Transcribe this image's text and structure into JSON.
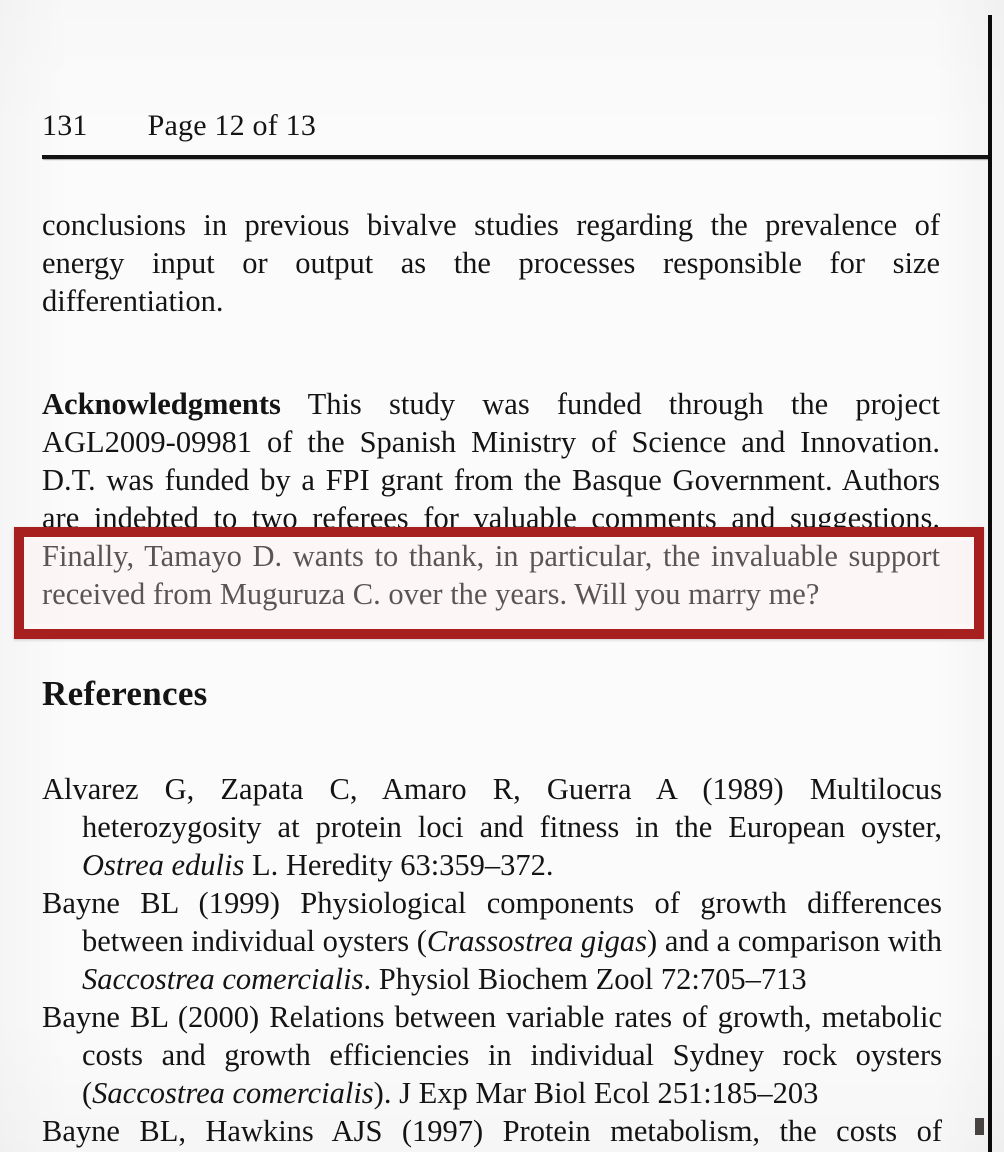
{
  "page": {
    "running_head": {
      "folio": "131",
      "page_indicator": "Page 12 of 13"
    }
  },
  "body": {
    "paragraph_conclusions": "conclusions in previous bivalve studies regarding the prevalence of energy input or output as the processes responsible for size differentiation.",
    "acknowledgments_label": "Acknowledgments",
    "acknowledgments_text": " This study was funded through the project AGL2009-09981 of the Spanish Ministry of Science and Innovation. D.T. was funded by a FPI grant from the Basque Government. Authors are indebted to two referees for valuable comments and suggestions. Finally, Tamayo D. wants to thank, in particular, the invaluable support received from Muguruza C. over the years. Will you marry me?"
  },
  "references": {
    "heading": "References",
    "items": [
      {
        "pre": "Alvarez G, Zapata C, Amaro R, Guerra A (1989) Multilocus heterozygosity at protein loci and fitness in the European oyster, ",
        "italic": "Ostrea edulis",
        "post": " L. Heredity 63:359–372."
      },
      {
        "pre": "Bayne BL (1999) Physiological components of growth differences between individual oysters (",
        "italic": "Crassostrea gigas",
        "mid": ") and a comparison with ",
        "italic2": "Saccostrea comercialis",
        "post": ". Physiol Biochem Zool 72:705–713"
      },
      {
        "pre": "Bayne BL (2000) Relations between variable rates of growth, metabolic costs and growth efficiencies in individual Sydney rock oysters (",
        "italic": "Saccostrea comercialis",
        "post": "). J Exp Mar Biol Ecol 251:185–203"
      },
      {
        "pre": "Bayne BL, Hawkins AJS (1997) Protein metabolism, the costs of",
        "italic": "",
        "post": ""
      }
    ]
  },
  "annotation": {
    "highlight_color": "#a81f1f",
    "highlighted_text": "tions. Finally, Tamayo D. wants to thank, in particular, the invaluable support received from Muguruza C. over the years. Will you marry me?"
  }
}
